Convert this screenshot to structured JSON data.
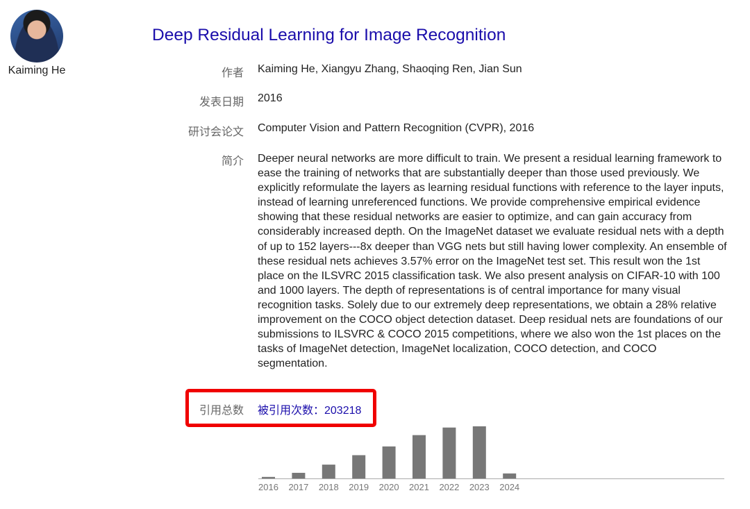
{
  "author": {
    "name": "Kaiming He"
  },
  "paper": {
    "title": "Deep Residual Learning for Image Recognition",
    "fields": [
      {
        "label": "作者",
        "value": "Kaiming He, Xiangyu Zhang, Shaoqing Ren, Jian Sun"
      },
      {
        "label": "发表日期",
        "value": "2016"
      },
      {
        "label": "研讨会论文",
        "value": "Computer Vision and Pattern Recognition (CVPR), 2016"
      }
    ],
    "abstract_label": "简介",
    "abstract": "Deeper neural networks are more difficult to train. We present a residual learning framework to ease the training of networks that are substantially deeper than those used previously. We explicitly reformulate the layers as learning residual functions with reference to the layer inputs, instead of learning unreferenced functions. We provide comprehensive empirical evidence showing that these residual networks are easier to optimize, and can gain accuracy from considerably increased depth. On the ImageNet dataset we evaluate residual nets with a depth of up to 152 layers---8x deeper than VGG nets but still having lower complexity. An ensemble of these residual nets achieves 3.57% error on the ImageNet test set. This result won the 1st place on the ILSVRC 2015 classification task. We also present analysis on CIFAR-10 with 100 and 1000 layers. The depth of representations is of central importance for many visual recognition tasks. Solely due to our extremely deep representations, we obtain a 28% relative improvement on the COCO object detection dataset. Deep residual nets are foundations of our submissions to ILSVRC & COCO 2015 competitions, where we also won the 1st places on the tasks of ImageNet detection, ImageNet localization, COCO detection, and COCO segmentation.",
    "citations_label": "引用总数",
    "citations_link": "被引用次数：203218"
  },
  "colors": {
    "link": "#1a0dab",
    "label": "#666666",
    "bar": "#777777",
    "highlight": "#f00000"
  },
  "chart_data": {
    "type": "bar",
    "categories": [
      "2016",
      "2017",
      "2018",
      "2019",
      "2020",
      "2021",
      "2022",
      "2023",
      "2024"
    ],
    "values": [
      1200,
      4500,
      11000,
      18500,
      25500,
      34500,
      40500,
      41500,
      4000
    ],
    "title": "",
    "xlabel": "",
    "ylabel": "",
    "ylim": [
      0,
      42000
    ],
    "grid": false
  }
}
